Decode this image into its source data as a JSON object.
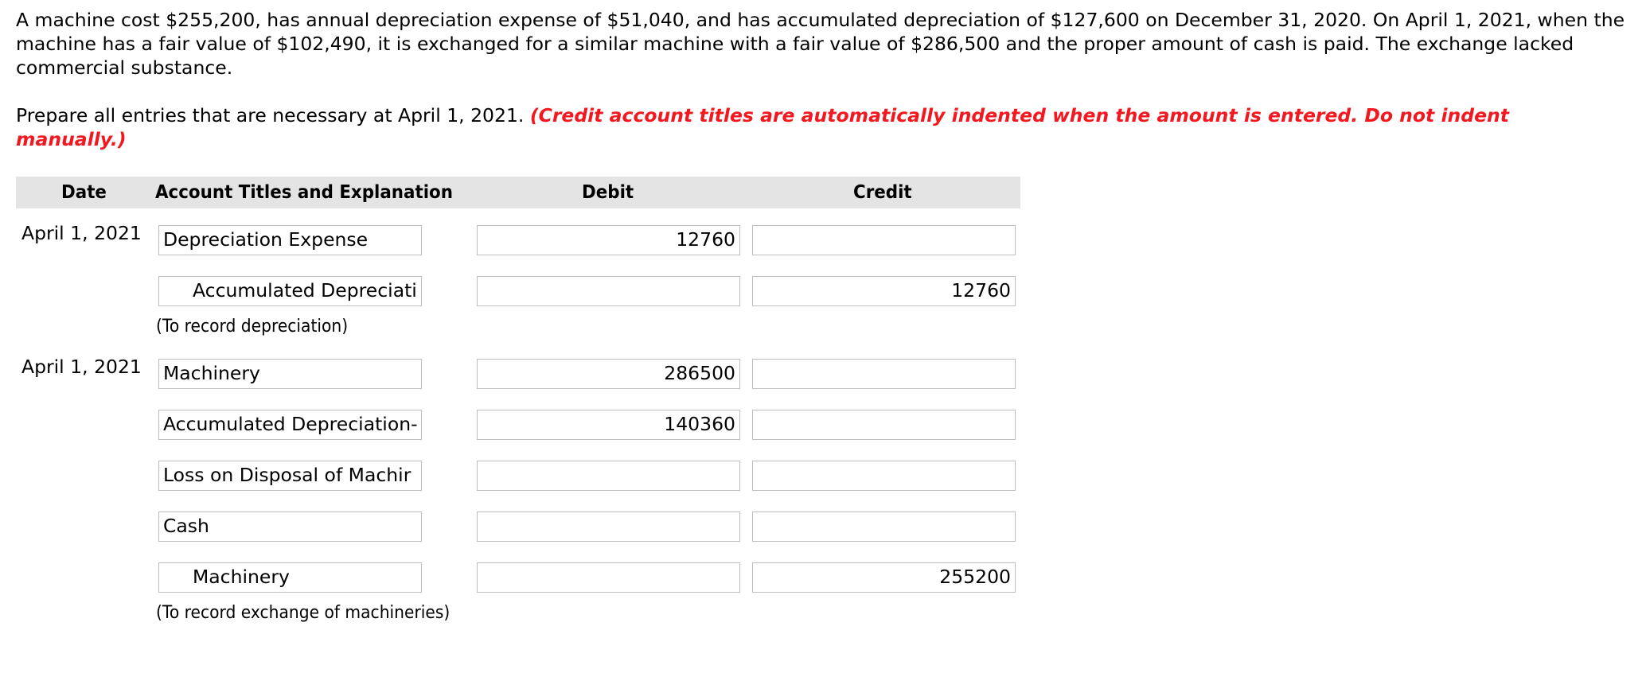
{
  "problem_text": "A machine cost $255,200, has annual depreciation expense of $51,040, and has accumulated depreciation of $127,600 on December 31, 2020. On April 1, 2021, when the machine has a fair value of $102,490, it is exchanged for a similar machine with a fair value of $286,500 and the proper amount of cash is paid. The exchange lacked commercial substance.",
  "instruction": {
    "text": "Prepare all entries that are necessary at April 1, 2021. ",
    "note": "(Credit account titles are automatically indented when the amount is entered. Do not indent manually.)",
    "note_color": "#f2181f"
  },
  "table": {
    "headers": {
      "date": "Date",
      "account": "Account Titles and Explanation",
      "debit": "Debit",
      "credit": "Credit"
    },
    "entries": [
      {
        "date": "April 1, 2021",
        "lines": [
          {
            "account": "Depreciation Expense",
            "debit": "12760",
            "credit": "",
            "indented": false
          },
          {
            "account": "Accumulated Depreciati",
            "debit": "",
            "credit": "12760",
            "indented": true
          }
        ],
        "explanation": "(To record depreciation)"
      },
      {
        "date": "April 1, 2021",
        "lines": [
          {
            "account": "Machinery",
            "debit": "286500",
            "credit": "",
            "indented": false
          },
          {
            "account": "Accumulated Depreciation-",
            "debit": "140360",
            "credit": "",
            "indented": false
          },
          {
            "account": "Loss on Disposal of Machir",
            "debit": "",
            "credit": "",
            "indented": false
          },
          {
            "account": "Cash",
            "debit": "",
            "credit": "",
            "indented": false
          },
          {
            "account": "Machinery",
            "debit": "",
            "credit": "255200",
            "indented": true
          }
        ],
        "explanation": "(To record exchange of machineries)"
      }
    ]
  }
}
